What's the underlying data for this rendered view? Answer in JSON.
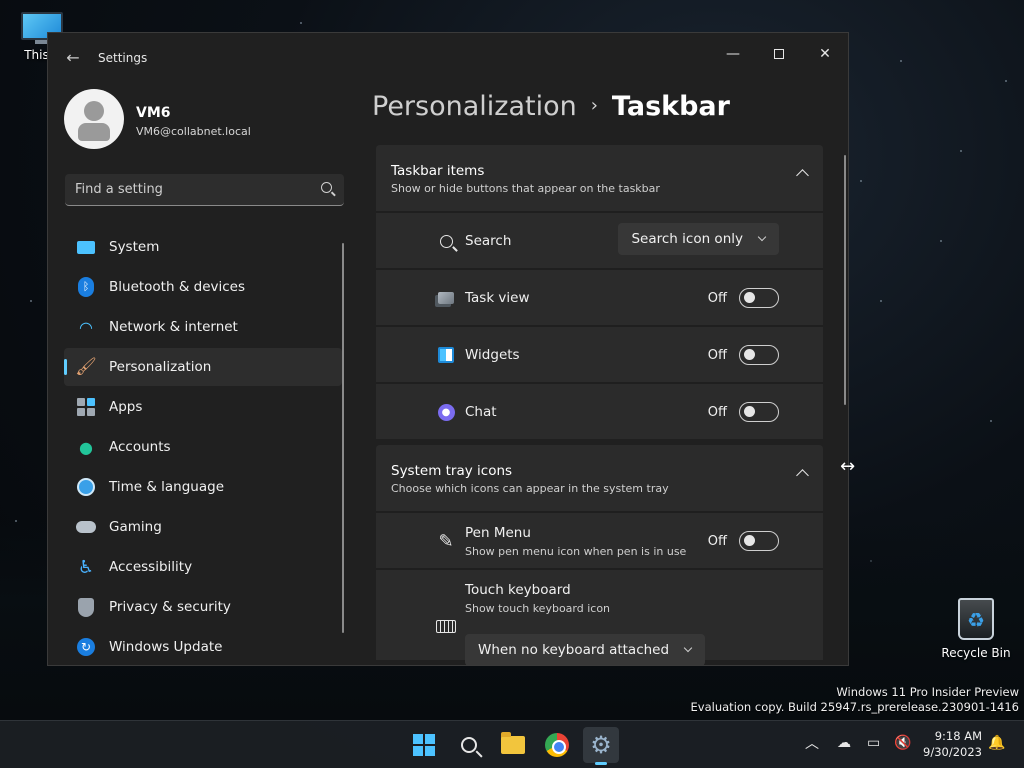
{
  "desktop": {
    "this_pc_label": "This P",
    "recycle_bin_label": "Recycle Bin"
  },
  "window": {
    "title": "Settings",
    "minimize_glyph": "—",
    "close_glyph": "✕"
  },
  "user": {
    "name": "VM6",
    "email": "VM6@collabnet.local"
  },
  "search": {
    "placeholder": "Find a setting"
  },
  "sidebar": {
    "items": [
      {
        "label": "System",
        "icon": "system-icon"
      },
      {
        "label": "Bluetooth & devices",
        "icon": "bluetooth-icon"
      },
      {
        "label": "Network & internet",
        "icon": "wifi-icon"
      },
      {
        "label": "Personalization",
        "icon": "brush-icon",
        "active": true
      },
      {
        "label": "Apps",
        "icon": "apps-icon"
      },
      {
        "label": "Accounts",
        "icon": "person-icon"
      },
      {
        "label": "Time & language",
        "icon": "globe-clock-icon"
      },
      {
        "label": "Gaming",
        "icon": "gamepad-icon"
      },
      {
        "label": "Accessibility",
        "icon": "accessibility-icon"
      },
      {
        "label": "Privacy & security",
        "icon": "shield-icon"
      },
      {
        "label": "Windows Update",
        "icon": "update-icon"
      }
    ]
  },
  "breadcrumb": {
    "parent": "Personalization",
    "separator": "›",
    "current": "Taskbar"
  },
  "taskbar_items": {
    "title": "Taskbar items",
    "subtitle": "Show or hide buttons that appear on the taskbar",
    "search": {
      "label": "Search",
      "value": "Search icon only"
    },
    "task_view": {
      "label": "Task view",
      "state": "Off"
    },
    "widgets": {
      "label": "Widgets",
      "state": "Off"
    },
    "chat": {
      "label": "Chat",
      "state": "Off"
    }
  },
  "system_tray": {
    "title": "System tray icons",
    "subtitle": "Choose which icons can appear in the system tray",
    "pen_menu": {
      "label": "Pen Menu",
      "sub": "Show pen menu icon when pen is in use",
      "state": "Off"
    },
    "touch_keyboard": {
      "label": "Touch keyboard",
      "sub": "Show touch keyboard icon",
      "value": "When no keyboard attached"
    }
  },
  "watermark": {
    "line1": "Windows 11 Pro Insider Preview",
    "line2": "Evaluation copy. Build 25947.rs_prerelease.230901-1416"
  },
  "clock": {
    "time": "9:18 AM",
    "date": "9/30/2023"
  },
  "colors": {
    "accent": "#60cdff",
    "window_bg": "#202020",
    "card_bg": "#2b2b2b"
  }
}
